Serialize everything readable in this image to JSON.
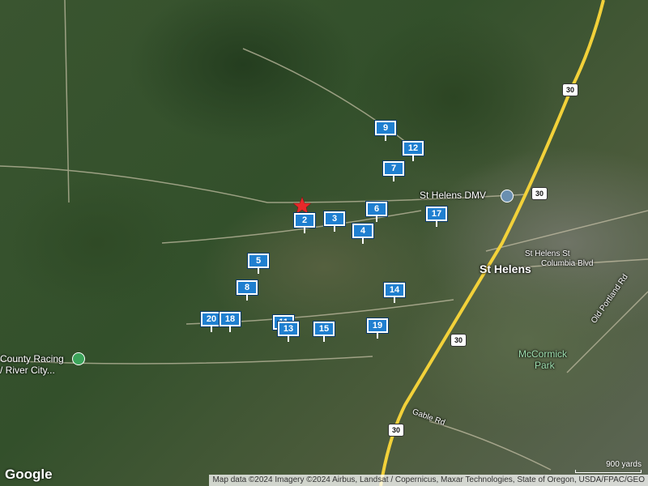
{
  "map": {
    "labels": {
      "dmv": "St Helens DMV",
      "city": "St Helens",
      "st_helens_st": "St Helens St",
      "columbia_blvd": "Columbia Blvd",
      "mccormick": "McCormick",
      "park": "Park",
      "old_portland": "Old Portland Rd",
      "gable": "Gable Rd",
      "racing1": "County Racing",
      "racing2": "/ River City..."
    },
    "shields": [
      "30",
      "30",
      "30",
      "30"
    ],
    "markers": [
      "9",
      "12",
      "7",
      "2",
      "3",
      "6",
      "17",
      "4",
      "5",
      "8",
      "14",
      "20",
      "18",
      "11",
      "13",
      "15",
      "19"
    ],
    "google": "Google",
    "scale": "900 yards",
    "attribution": "Map data ©2024 Imagery ©2024 Airbus, Landsat / Copernicus, Maxar Technologies, State of Oregon, USDA/FPAC/GEO",
    "colors": {
      "marker": "#1f7fd0",
      "highway": "#f2d13a",
      "dmv_icon": "#6a8fb0",
      "poi_icon": "#3ca35a",
      "star": "#e8292a"
    }
  }
}
